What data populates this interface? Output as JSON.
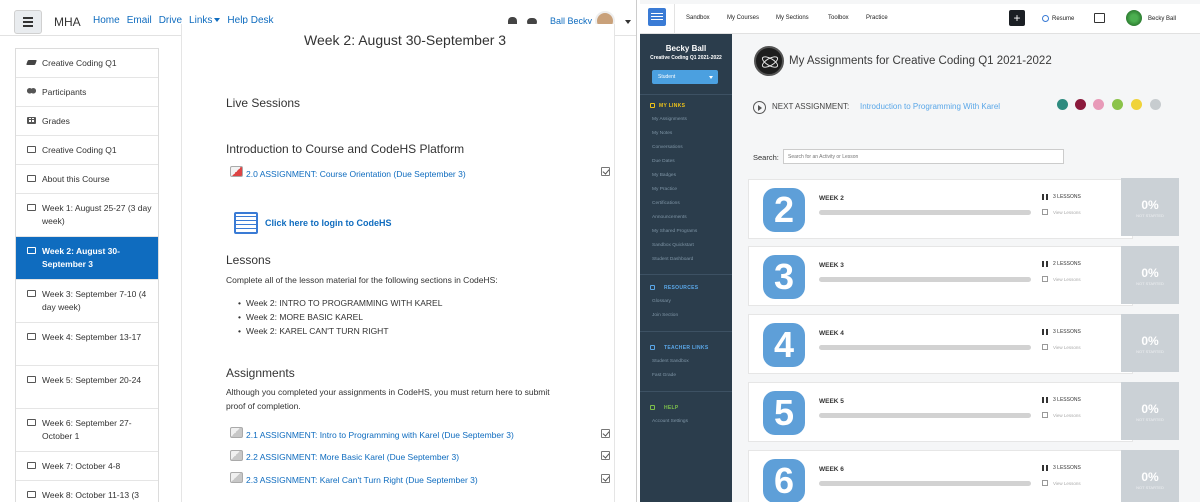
{
  "moodle": {
    "brand": "MHA",
    "nav": [
      "Home",
      "Email",
      "Drive",
      "Links",
      "Help Desk"
    ],
    "user_name": "Ball Becky",
    "sidebar": [
      "Creative Coding Q1",
      "Participants",
      "Grades",
      "Creative Coding Q1",
      "About this Course",
      "Week 1: August 25-27 (3 day week)",
      "Week 2: August 30-September 3",
      "Week 3: September 7-10 (4 day week)",
      "Week 4: September 13-17",
      "Week 5: September 20-24",
      "Week 6: September 27-October 1",
      "Week 7: October 4-8",
      "Week 8: October 11-13 (3"
    ],
    "page_title": "Week 2: August 30-September 3",
    "live_sessions": "Live Sessions",
    "intro_heading": "Introduction to Course and CodeHS Platform",
    "orientation_link": "2.0 ASSIGNMENT: Course Orientation (Due September 3)",
    "codehs_link": "Click here to login to CodeHS",
    "lessons_heading": "Lessons",
    "lessons_text": "Complete all of the lesson material for the following sections in CodeHS:",
    "lesson_items": [
      "Week 2: INTRO TO PROGRAMMING WITH KAREL",
      "Week 2: MORE BASIC KAREL",
      "Week 2: KAREL CAN'T TURN RIGHT"
    ],
    "assignments_heading": "Assignments",
    "assignments_text_1": "Although you completed your assignments in CodeHS, you must return here to submit",
    "assignments_text_2": "proof of completion.",
    "assignment_links": [
      "2.1 ASSIGNMENT: Intro to Programming with Karel (Due September 3)",
      "2.2 ASSIGNMENT: More Basic Karel (Due September 3)",
      "2.3 ASSIGNMENT: Karel Can't Turn Right (Due September 3)"
    ]
  },
  "codehs": {
    "nav": [
      "Sandbox",
      "My Courses",
      "My Sections",
      "Toolbox",
      "Practice"
    ],
    "plus": "+",
    "resume": "Resume",
    "user_name": "Becky Ball",
    "sidebar_name": "Becky Ball",
    "sidebar_course": "Creative Coding Q1 2021-2022",
    "role": "Student",
    "my_links_head": "MY LINKS",
    "my_links": [
      "My Assignments",
      "My Notes",
      "Conversations",
      "Due Dates",
      "My Badges",
      "My Practice",
      "Certifications",
      "Announcements",
      "My Shared Programs",
      "Sandbox Quickstart",
      "Student Dashboard"
    ],
    "resources_head": "RESOURCES",
    "resources": [
      "Glossary",
      "Join Section"
    ],
    "teacher_head": "TEACHER LINKS",
    "teacher_links": [
      "Student Sandbox",
      "Fast Grade"
    ],
    "help_head": "HELP",
    "help_links": [
      "Account Settings"
    ],
    "title": "My Assignments for Creative Coding Q1 2021-2022",
    "next_label": "NEXT ASSIGNMENT:",
    "next_link": "Introduction to Programming With Karel",
    "theme_colors": [
      "#2e8b7f",
      "#8b1a3c",
      "#e89ab8",
      "#8bc34a",
      "#f0d33a",
      "#c7cccf"
    ],
    "search_label": "Search:",
    "search_placeholder": "Search for an Activity or Lesson",
    "units": [
      {
        "num": "2",
        "week": "WEEK 2",
        "lessons": "3 LESSONS",
        "view": "View Lessons",
        "pct": "0%",
        "status": "NOT STARTED",
        "progress": 0
      },
      {
        "num": "3",
        "week": "WEEK 3",
        "lessons": "2 LESSONS",
        "view": "View Lessons",
        "pct": "0%",
        "status": "NOT STARTED",
        "progress": 0
      },
      {
        "num": "4",
        "week": "WEEK 4",
        "lessons": "3 LESSONS",
        "view": "View Lessons",
        "pct": "0%",
        "status": "NOT STARTED",
        "progress": 0
      },
      {
        "num": "5",
        "week": "WEEK 5",
        "lessons": "3 LESSONS",
        "view": "View Lessons",
        "pct": "0%",
        "status": "NOT STARTED",
        "progress": 0
      },
      {
        "num": "6",
        "week": "WEEK 6",
        "lessons": "3 LESSONS",
        "view": "View Lessons",
        "pct": "0%",
        "status": "NOT STARTED",
        "progress": 0
      }
    ]
  }
}
